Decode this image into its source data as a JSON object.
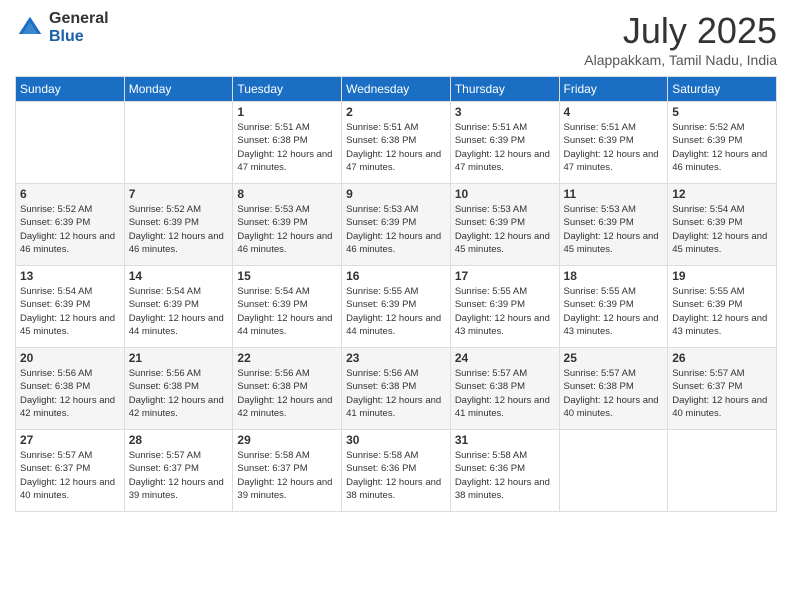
{
  "logo": {
    "general": "General",
    "blue": "Blue"
  },
  "title": {
    "month_year": "July 2025",
    "location": "Alappakkam, Tamil Nadu, India"
  },
  "days_of_week": [
    "Sunday",
    "Monday",
    "Tuesday",
    "Wednesday",
    "Thursday",
    "Friday",
    "Saturday"
  ],
  "weeks": [
    [
      {
        "day": "",
        "sunrise": "",
        "sunset": "",
        "daylight": ""
      },
      {
        "day": "",
        "sunrise": "",
        "sunset": "",
        "daylight": ""
      },
      {
        "day": "1",
        "sunrise": "Sunrise: 5:51 AM",
        "sunset": "Sunset: 6:38 PM",
        "daylight": "Daylight: 12 hours and 47 minutes."
      },
      {
        "day": "2",
        "sunrise": "Sunrise: 5:51 AM",
        "sunset": "Sunset: 6:38 PM",
        "daylight": "Daylight: 12 hours and 47 minutes."
      },
      {
        "day": "3",
        "sunrise": "Sunrise: 5:51 AM",
        "sunset": "Sunset: 6:39 PM",
        "daylight": "Daylight: 12 hours and 47 minutes."
      },
      {
        "day": "4",
        "sunrise": "Sunrise: 5:51 AM",
        "sunset": "Sunset: 6:39 PM",
        "daylight": "Daylight: 12 hours and 47 minutes."
      },
      {
        "day": "5",
        "sunrise": "Sunrise: 5:52 AM",
        "sunset": "Sunset: 6:39 PM",
        "daylight": "Daylight: 12 hours and 46 minutes."
      }
    ],
    [
      {
        "day": "6",
        "sunrise": "Sunrise: 5:52 AM",
        "sunset": "Sunset: 6:39 PM",
        "daylight": "Daylight: 12 hours and 46 minutes."
      },
      {
        "day": "7",
        "sunrise": "Sunrise: 5:52 AM",
        "sunset": "Sunset: 6:39 PM",
        "daylight": "Daylight: 12 hours and 46 minutes."
      },
      {
        "day": "8",
        "sunrise": "Sunrise: 5:53 AM",
        "sunset": "Sunset: 6:39 PM",
        "daylight": "Daylight: 12 hours and 46 minutes."
      },
      {
        "day": "9",
        "sunrise": "Sunrise: 5:53 AM",
        "sunset": "Sunset: 6:39 PM",
        "daylight": "Daylight: 12 hours and 46 minutes."
      },
      {
        "day": "10",
        "sunrise": "Sunrise: 5:53 AM",
        "sunset": "Sunset: 6:39 PM",
        "daylight": "Daylight: 12 hours and 45 minutes."
      },
      {
        "day": "11",
        "sunrise": "Sunrise: 5:53 AM",
        "sunset": "Sunset: 6:39 PM",
        "daylight": "Daylight: 12 hours and 45 minutes."
      },
      {
        "day": "12",
        "sunrise": "Sunrise: 5:54 AM",
        "sunset": "Sunset: 6:39 PM",
        "daylight": "Daylight: 12 hours and 45 minutes."
      }
    ],
    [
      {
        "day": "13",
        "sunrise": "Sunrise: 5:54 AM",
        "sunset": "Sunset: 6:39 PM",
        "daylight": "Daylight: 12 hours and 45 minutes."
      },
      {
        "day": "14",
        "sunrise": "Sunrise: 5:54 AM",
        "sunset": "Sunset: 6:39 PM",
        "daylight": "Daylight: 12 hours and 44 minutes."
      },
      {
        "day": "15",
        "sunrise": "Sunrise: 5:54 AM",
        "sunset": "Sunset: 6:39 PM",
        "daylight": "Daylight: 12 hours and 44 minutes."
      },
      {
        "day": "16",
        "sunrise": "Sunrise: 5:55 AM",
        "sunset": "Sunset: 6:39 PM",
        "daylight": "Daylight: 12 hours and 44 minutes."
      },
      {
        "day": "17",
        "sunrise": "Sunrise: 5:55 AM",
        "sunset": "Sunset: 6:39 PM",
        "daylight": "Daylight: 12 hours and 43 minutes."
      },
      {
        "day": "18",
        "sunrise": "Sunrise: 5:55 AM",
        "sunset": "Sunset: 6:39 PM",
        "daylight": "Daylight: 12 hours and 43 minutes."
      },
      {
        "day": "19",
        "sunrise": "Sunrise: 5:55 AM",
        "sunset": "Sunset: 6:39 PM",
        "daylight": "Daylight: 12 hours and 43 minutes."
      }
    ],
    [
      {
        "day": "20",
        "sunrise": "Sunrise: 5:56 AM",
        "sunset": "Sunset: 6:38 PM",
        "daylight": "Daylight: 12 hours and 42 minutes."
      },
      {
        "day": "21",
        "sunrise": "Sunrise: 5:56 AM",
        "sunset": "Sunset: 6:38 PM",
        "daylight": "Daylight: 12 hours and 42 minutes."
      },
      {
        "day": "22",
        "sunrise": "Sunrise: 5:56 AM",
        "sunset": "Sunset: 6:38 PM",
        "daylight": "Daylight: 12 hours and 42 minutes."
      },
      {
        "day": "23",
        "sunrise": "Sunrise: 5:56 AM",
        "sunset": "Sunset: 6:38 PM",
        "daylight": "Daylight: 12 hours and 41 minutes."
      },
      {
        "day": "24",
        "sunrise": "Sunrise: 5:57 AM",
        "sunset": "Sunset: 6:38 PM",
        "daylight": "Daylight: 12 hours and 41 minutes."
      },
      {
        "day": "25",
        "sunrise": "Sunrise: 5:57 AM",
        "sunset": "Sunset: 6:38 PM",
        "daylight": "Daylight: 12 hours and 40 minutes."
      },
      {
        "day": "26",
        "sunrise": "Sunrise: 5:57 AM",
        "sunset": "Sunset: 6:37 PM",
        "daylight": "Daylight: 12 hours and 40 minutes."
      }
    ],
    [
      {
        "day": "27",
        "sunrise": "Sunrise: 5:57 AM",
        "sunset": "Sunset: 6:37 PM",
        "daylight": "Daylight: 12 hours and 40 minutes."
      },
      {
        "day": "28",
        "sunrise": "Sunrise: 5:57 AM",
        "sunset": "Sunset: 6:37 PM",
        "daylight": "Daylight: 12 hours and 39 minutes."
      },
      {
        "day": "29",
        "sunrise": "Sunrise: 5:58 AM",
        "sunset": "Sunset: 6:37 PM",
        "daylight": "Daylight: 12 hours and 39 minutes."
      },
      {
        "day": "30",
        "sunrise": "Sunrise: 5:58 AM",
        "sunset": "Sunset: 6:36 PM",
        "daylight": "Daylight: 12 hours and 38 minutes."
      },
      {
        "day": "31",
        "sunrise": "Sunrise: 5:58 AM",
        "sunset": "Sunset: 6:36 PM",
        "daylight": "Daylight: 12 hours and 38 minutes."
      },
      {
        "day": "",
        "sunrise": "",
        "sunset": "",
        "daylight": ""
      },
      {
        "day": "",
        "sunrise": "",
        "sunset": "",
        "daylight": ""
      }
    ]
  ]
}
